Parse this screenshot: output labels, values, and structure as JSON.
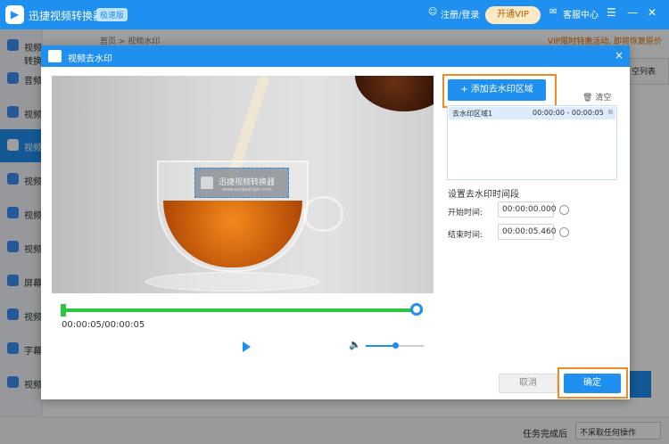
{
  "app": {
    "title": "迅捷视频转换器",
    "edition_badge": "极速版",
    "login_label": "注册/登录",
    "vip_label": "开通VIP",
    "service_label": "客服中心"
  },
  "sidebar": {
    "items": [
      {
        "label": "视频转换"
      },
      {
        "label": "音频"
      },
      {
        "label": "视频"
      },
      {
        "label": "视频"
      },
      {
        "label": "视频"
      },
      {
        "label": "视频"
      },
      {
        "label": "视频"
      },
      {
        "label": "屏幕"
      },
      {
        "label": "视频"
      },
      {
        "label": "字幕"
      },
      {
        "label": "视频"
      }
    ]
  },
  "background": {
    "breadcrumb": "首页 > 视频水印",
    "promo": "VIP限时特惠活动, 即将恢复原价",
    "panel_label": "空列表",
    "task_done_label": "任务完成后",
    "task_done_option": "不采取任何操作"
  },
  "dialog": {
    "title": "视频去水印",
    "close_icon": "×",
    "watermark_text": "迅捷视频转换器",
    "watermark_url": "www.xunjieshipin.com",
    "time_display": "00:00:05/00:00:05",
    "volume_level": 0.5,
    "add_region_label": "添加去水印区域",
    "clear_label": "清空",
    "regions": [
      {
        "name": "去水印区域1",
        "time_range": "00:00:00 - 00:00:05"
      }
    ],
    "time_section_title": "设置去水印时间段",
    "start_label": "开始时间:",
    "start_value": "00:00:00.000",
    "end_label": "结束时间:",
    "end_value": "00:00:05.460",
    "cancel_label": "取消",
    "confirm_label": "确定"
  }
}
